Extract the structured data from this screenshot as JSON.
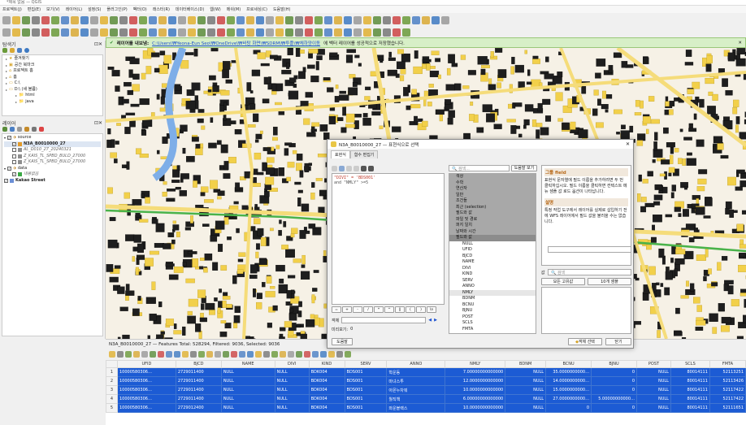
{
  "app": {
    "title": "*제목 없음 — QGIS"
  },
  "menu": [
    "프로젝트(J)",
    "편집(E)",
    "보기(V)",
    "레이어(L)",
    "설정(S)",
    "플러그인(P)",
    "벡터(O)",
    "래스터(R)",
    "데이터베이스(D)",
    "웹(W)",
    "메쉬(M)",
    "프로세싱(C)",
    "도움말(H)"
  ],
  "browser": {
    "title": "탐색기",
    "items": [
      "즐겨찾기",
      "공간 북마크",
      "프로젝트 홈",
      "홈",
      "C:\\",
      "D:\\ (새 볼륨)",
      "html",
      "java"
    ]
  },
  "layers": {
    "title": "레이어",
    "groups": [
      {
        "name": "source",
        "children": [
          "N3A_B0010000_27",
          "AL_D010_27_20240321",
          "Z_KAIS_TL_SPBD_BULD_27000",
          "Z_KAIS_TL_SPBD_BULD_27000"
        ]
      },
      {
        "name": "data",
        "children": [
          "내용없음"
        ]
      }
    ],
    "basemap": "Kakao Street"
  },
  "message": {
    "label": "레이어를 내보냄:",
    "path": "C:\\Users\\₩Yeona-Eun Seo\\₩OneDrive\\₩바탕 화면\\₩SDRM\\₩투플\\₩체하양이동",
    "suffix": "에 벡터 레이어를 성공적으로 저장했습니다.",
    "close": "✕"
  },
  "dialog": {
    "title": "N3A_B0010000_27 — 표현식으로 선택",
    "tabs": [
      "표현식",
      "함수 편집기"
    ],
    "expression": [
      "\"DIVI\" = 'BDS001'",
      "and \"NMLY\" >=5"
    ],
    "search_placeholder": "검색...",
    "show_help": "도움말 보기",
    "groups": [
      "색상",
      "수학",
      "연산자",
      "일반",
      "조건들",
      "최근 (selection)",
      "필드와 값",
      "파일 및 경로",
      "퍼지 일치",
      "날짜와 시간"
    ],
    "fields_header": "필드와 값",
    "fields": [
      "NULL",
      "UFID",
      "BJCD",
      "NAME",
      "DIVI",
      "KIND",
      "SERV",
      "ANNO",
      "NMLY",
      "BDNM",
      "BCNU",
      "BJNU",
      "POST",
      "SCLS",
      "FMTA"
    ],
    "help_title": "그룹 field",
    "help_text": "표현식 문자열에 필드 이름을 추가하려면 두 번 클릭하십시오. 필드 이름을 클릭하면 컨텍스트 메뉴 샘플 값 로드 옵션이 나타납니다.",
    "notes_title": "설명",
    "notes_text": "특정 작업 도구에서 레이어를 실제로 삽입하기 전에 WFS 레이어에서 필드 값을 불러올 수는 없습니다.",
    "value_search": "검색",
    "all_unique": "모든 고유값",
    "samples": "10개 샘플",
    "feature_label": "객체",
    "preview_label": "미리보기:",
    "preview_value": "0",
    "help_btn": "도움말",
    "select_btn": "객체 선택",
    "close_btn": "닫기"
  },
  "attr": {
    "status": "N3A_B0010000_27 — Features Total: 528294, Filtered: 9036, Selected: 9036",
    "columns": [
      "UFID",
      "BJCD",
      "NAME",
      "DIVI",
      "KIND",
      "SERV",
      "ANNO",
      "NMLY",
      "BDNM",
      "BCNU",
      "BJNU",
      "POST",
      "SCLS",
      "FMTA"
    ],
    "rows": [
      [
        "10000580306…",
        "2729011400",
        "NULL",
        "NULL",
        "BDK004",
        "BDS001",
        "학운동",
        "7.00000000000000",
        "NULL",
        "35.0000000000…",
        "0",
        "NULL",
        "80014111",
        "52113251"
      ],
      [
        "10000580306…",
        "2729011400",
        "NULL",
        "NULL",
        "BDK004",
        "BDS001",
        "마녀스투",
        "12.0000000000000",
        "NULL",
        "14.0000000000…",
        "0",
        "NULL",
        "80014111",
        "52113426"
      ],
      [
        "10000580306…",
        "2729011400",
        "NULL",
        "NULL",
        "BDK004",
        "BDS001",
        "아몬누차뭐",
        "10.0000000000000",
        "NULL",
        "15.0000000000…",
        "0",
        "NULL",
        "80014111",
        "52117422"
      ],
      [
        "10000580306…",
        "2729011400",
        "NULL",
        "NULL",
        "BDK004",
        "BDS001",
        "월직책",
        "6.00000000000000",
        "NULL",
        "27.0000000000…",
        "5.00000000000…",
        "NULL",
        "80014111",
        "52117422"
      ],
      [
        "10000580306…",
        "2729012400",
        "NULL",
        "NULL",
        "BDK004",
        "BDS001",
        "와운블랙스",
        "10.0000000000000",
        "NULL",
        "0",
        "0",
        "NULL",
        "80014111",
        "52111651"
      ]
    ]
  },
  "colors": {
    "selected_row": "#1c5bd4",
    "road_major": "#f0c64a",
    "road_green": "#4ab34a",
    "building": "#f2d04a",
    "river": "#7eaee8"
  }
}
